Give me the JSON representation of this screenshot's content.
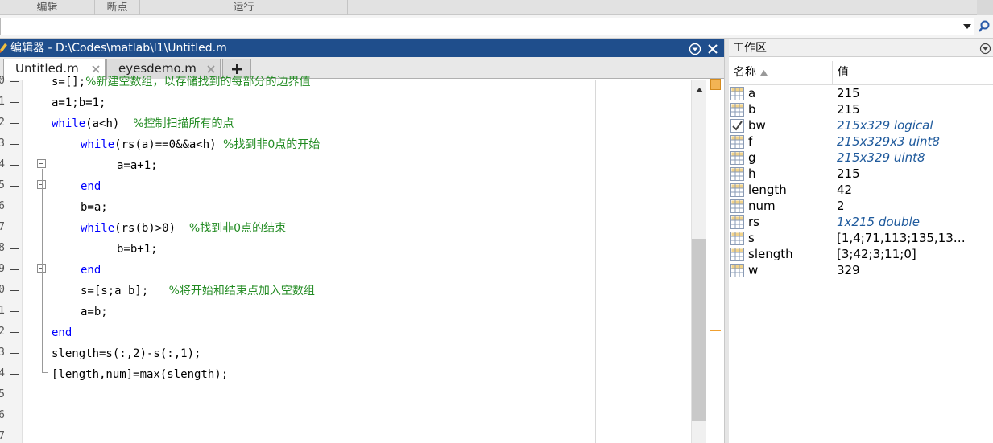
{
  "toolstrip": {
    "sections": [
      "编辑",
      "断点",
      "运行"
    ]
  },
  "address_bar": {
    "value": ""
  },
  "editor": {
    "title": "编辑器 - D:\\Codes\\matlab\\l1\\Untitled.m",
    "tabs": [
      {
        "label": "Untitled.m",
        "active": true
      },
      {
        "label": "eyesdemo.m",
        "active": false
      }
    ],
    "add_tab_label": "+",
    "line_numbers": [
      "0",
      "1",
      "2",
      "3",
      "4",
      "5",
      "6",
      "7",
      "8",
      "9",
      "0",
      "1",
      "2",
      "3",
      "4",
      "5",
      "6",
      "7"
    ],
    "lines": [
      {
        "code": "s=[];",
        "comment": "%新建空数组，以存储找到的每部分的边界值"
      },
      {
        "code": "a=1;b=1;",
        "comment": ""
      },
      {
        "kw": "while",
        "code": "(a<h)  ",
        "comment": "%控制扫描所有的点"
      },
      {
        "kw": "while",
        "code": "(rs(a)==0&&a<h) ",
        "comment": "%找到非0点的开始"
      },
      {
        "code": "a=a+1;",
        "comment": ""
      },
      {
        "kw": "end",
        "code": "",
        "comment": ""
      },
      {
        "code": "b=a;",
        "comment": ""
      },
      {
        "kw": "while",
        "code": "(rs(b)>0)  ",
        "comment": "%找到非0点的结束"
      },
      {
        "code": "b=b+1;",
        "comment": ""
      },
      {
        "kw": "end",
        "code": "",
        "comment": ""
      },
      {
        "code": "s=[s;a b];   ",
        "comment": "%将开始和结束点加入空数组"
      },
      {
        "code": "a=b;",
        "comment": ""
      },
      {
        "kw": "end",
        "code": "",
        "comment": ""
      },
      {
        "code": "slength=s(:,2)-s(:,1);",
        "comment": ""
      },
      {
        "code": "[length,num]=max(slength);",
        "comment": ""
      }
    ]
  },
  "workspace": {
    "title": "工作区",
    "columns": {
      "name": "名称",
      "value": "值"
    },
    "variables": [
      {
        "name": "a",
        "value": "215",
        "type": "numeric",
        "italic": false
      },
      {
        "name": "b",
        "value": "215",
        "type": "numeric",
        "italic": false
      },
      {
        "name": "bw",
        "value": "215x329 logical",
        "type": "logical",
        "italic": true
      },
      {
        "name": "f",
        "value": "215x329x3 uint8",
        "type": "numeric",
        "italic": true
      },
      {
        "name": "g",
        "value": "215x329 uint8",
        "type": "numeric",
        "italic": true
      },
      {
        "name": "h",
        "value": "215",
        "type": "numeric",
        "italic": false
      },
      {
        "name": "length",
        "value": "42",
        "type": "numeric",
        "italic": false
      },
      {
        "name": "num",
        "value": "2",
        "type": "numeric",
        "italic": false
      },
      {
        "name": "rs",
        "value": "1x215 double",
        "type": "numeric",
        "italic": true
      },
      {
        "name": "s",
        "value": "[1,4;71,113;135,13…",
        "type": "numeric",
        "italic": false
      },
      {
        "name": "slength",
        "value": "[3;42;3;11;0]",
        "type": "numeric",
        "italic": false
      },
      {
        "name": "w",
        "value": "329",
        "type": "numeric",
        "italic": false
      }
    ]
  },
  "colors": {
    "title_bar": "#1f4e8c",
    "keyword": "#0000ff",
    "comment": "#228b22",
    "italic_value": "#1f5a9c",
    "marker": "#f3b454"
  }
}
